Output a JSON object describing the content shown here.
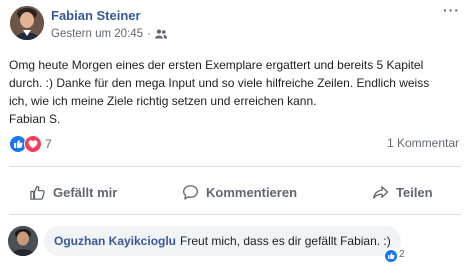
{
  "post": {
    "author": "Fabian Steiner",
    "timestamp": "Gestern um 20:45",
    "separator": "·",
    "audience_icon": "friends-icon",
    "more_label": "···",
    "text_lines": [
      "Omg heute Morgen eines der ersten Exemplare ergattert und bereits 5 Kapitel",
      "durch. :) Danke für den mega Input und so viele hilfreiche Zeilen. Endlich weiss",
      "ich, wie ich meine Ziele richtig setzen und erreichen kann.",
      "Fabian S."
    ]
  },
  "reactions": {
    "icons": [
      "like-icon",
      "love-icon"
    ],
    "count": "7",
    "comments": "1 Kommentar",
    "like_color": "#1877f2",
    "love_color": "#f33e58"
  },
  "actions": {
    "like": "Gefällt mir",
    "comment": "Kommentieren",
    "share": "Teilen"
  },
  "comment": {
    "author": "Oguzhan Kayikcioglu",
    "text": "Freut mich, dass es dir gefällt Fabian. :)",
    "like_count": "2"
  },
  "colors": {
    "link": "#385898",
    "secondary_text": "#606770",
    "bubble": "#f2f3f5"
  }
}
